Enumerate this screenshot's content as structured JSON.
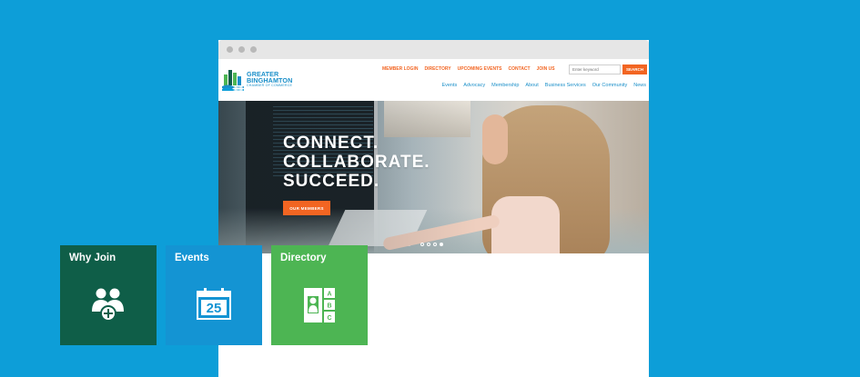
{
  "colors": {
    "background": "#0d9ed8",
    "accent_orange": "#f26522",
    "brand_blue": "#1a8fc9",
    "tile_why_join": "#0f5e48",
    "tile_events": "#1494d3",
    "tile_directory": "#4db553"
  },
  "logo": {
    "line1": "GREATER",
    "line2": "BINGHAMTON",
    "line3": "CHAMBER OF COMMERCE"
  },
  "topnav": [
    "MEMBER LOGIN",
    "DIRECTORY",
    "UPCOMING EVENTS",
    "CONTACT",
    "JOIN US"
  ],
  "search": {
    "placeholder": "Enter keyword",
    "button": "SEARCH"
  },
  "mainnav": [
    "Events",
    "Advocacy",
    "Membership",
    "About",
    "Business Services",
    "Our Community",
    "News"
  ],
  "hero": {
    "lines": [
      "CONNECT.",
      "COLLABORATE.",
      "SUCCEED."
    ],
    "button": "OUR MEMBERS",
    "slides": 4,
    "active_slide": 4
  },
  "tiles": [
    {
      "title": "Why Join",
      "icon": "people-add-icon"
    },
    {
      "title": "Events",
      "icon": "calendar-icon",
      "icon_number": "25"
    },
    {
      "title": "Directory",
      "icon": "directory-icon",
      "icon_letters": [
        "A",
        "B",
        "C"
      ]
    }
  ]
}
